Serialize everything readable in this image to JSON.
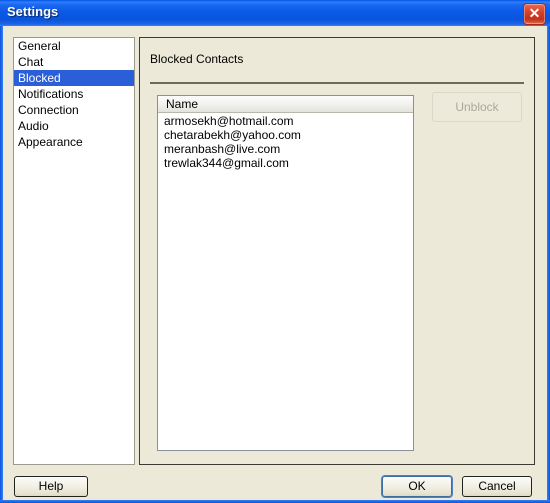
{
  "window": {
    "title": "Settings",
    "close_icon": "close-icon",
    "close_glyph": "✕"
  },
  "colors": {
    "titlebar_blue": "#0a54dd",
    "dialog_background": "#ece9d8",
    "selection_blue": "#2b5fd9",
    "close_red": "#d8452a",
    "disabled_text": "#aca899"
  },
  "sidebar": {
    "items": [
      {
        "label": "General",
        "selected": false
      },
      {
        "label": "Chat",
        "selected": false
      },
      {
        "label": "Blocked",
        "selected": true
      },
      {
        "label": "Notifications",
        "selected": false
      },
      {
        "label": "Connection",
        "selected": false
      },
      {
        "label": "Audio",
        "selected": false
      },
      {
        "label": "Appearance",
        "selected": false
      }
    ]
  },
  "panel": {
    "heading": "Blocked Contacts",
    "list": {
      "columns": [
        "Name"
      ],
      "rows": [
        "armosekh@hotmail.com",
        "chetarabekh@yahoo.com",
        "meranbash@live.com",
        "trewlak344@gmail.com"
      ]
    },
    "unblock_button": {
      "label": "Unblock",
      "enabled": false
    }
  },
  "footer": {
    "help_label": "Help",
    "ok_label": "OK",
    "cancel_label": "Cancel"
  }
}
